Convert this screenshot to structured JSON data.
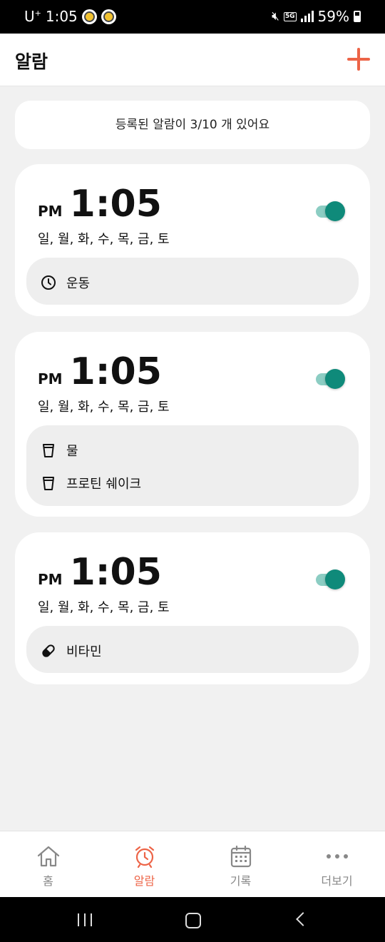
{
  "status_bar": {
    "carrier": "U",
    "carrier_sup": "+",
    "time": "1:05",
    "network": "5G",
    "battery": "59%"
  },
  "header": {
    "title": "알람",
    "add_icon": "plus-icon"
  },
  "summary": {
    "text": "등록된 알람이 3/10 개 있어요"
  },
  "alarms": [
    {
      "ampm": "PM",
      "time": "1:05",
      "days": "일, 월, 화, 수, 목, 금, 토",
      "enabled": true,
      "items": [
        {
          "icon": "clock-icon",
          "label": "운동"
        }
      ]
    },
    {
      "ampm": "PM",
      "time": "1:05",
      "days": "일, 월, 화, 수, 목, 금, 토",
      "enabled": true,
      "items": [
        {
          "icon": "cup-icon",
          "label": "물"
        },
        {
          "icon": "cup-icon",
          "label": "프로틴 쉐이크"
        }
      ]
    },
    {
      "ampm": "PM",
      "time": "1:05",
      "days": "일, 월, 화, 수, 목, 금, 토",
      "enabled": true,
      "items": [
        {
          "icon": "pill-icon",
          "label": "비타민"
        }
      ]
    }
  ],
  "bottom_nav": {
    "items": [
      {
        "label": "홈",
        "icon": "home-icon",
        "active": false
      },
      {
        "label": "알람",
        "icon": "alarm-clock-icon",
        "active": true
      },
      {
        "label": "기록",
        "icon": "calendar-icon",
        "active": false
      },
      {
        "label": "더보기",
        "icon": "more-icon",
        "active": false
      }
    ]
  },
  "colors": {
    "accent": "#ed6447",
    "toggle_on": "#0f8a7a",
    "toggle_track": "#8ccdc3",
    "background": "#f1f1f1",
    "card": "#ffffff",
    "tag_box": "#eeeeee",
    "nav_inactive": "#888888"
  }
}
